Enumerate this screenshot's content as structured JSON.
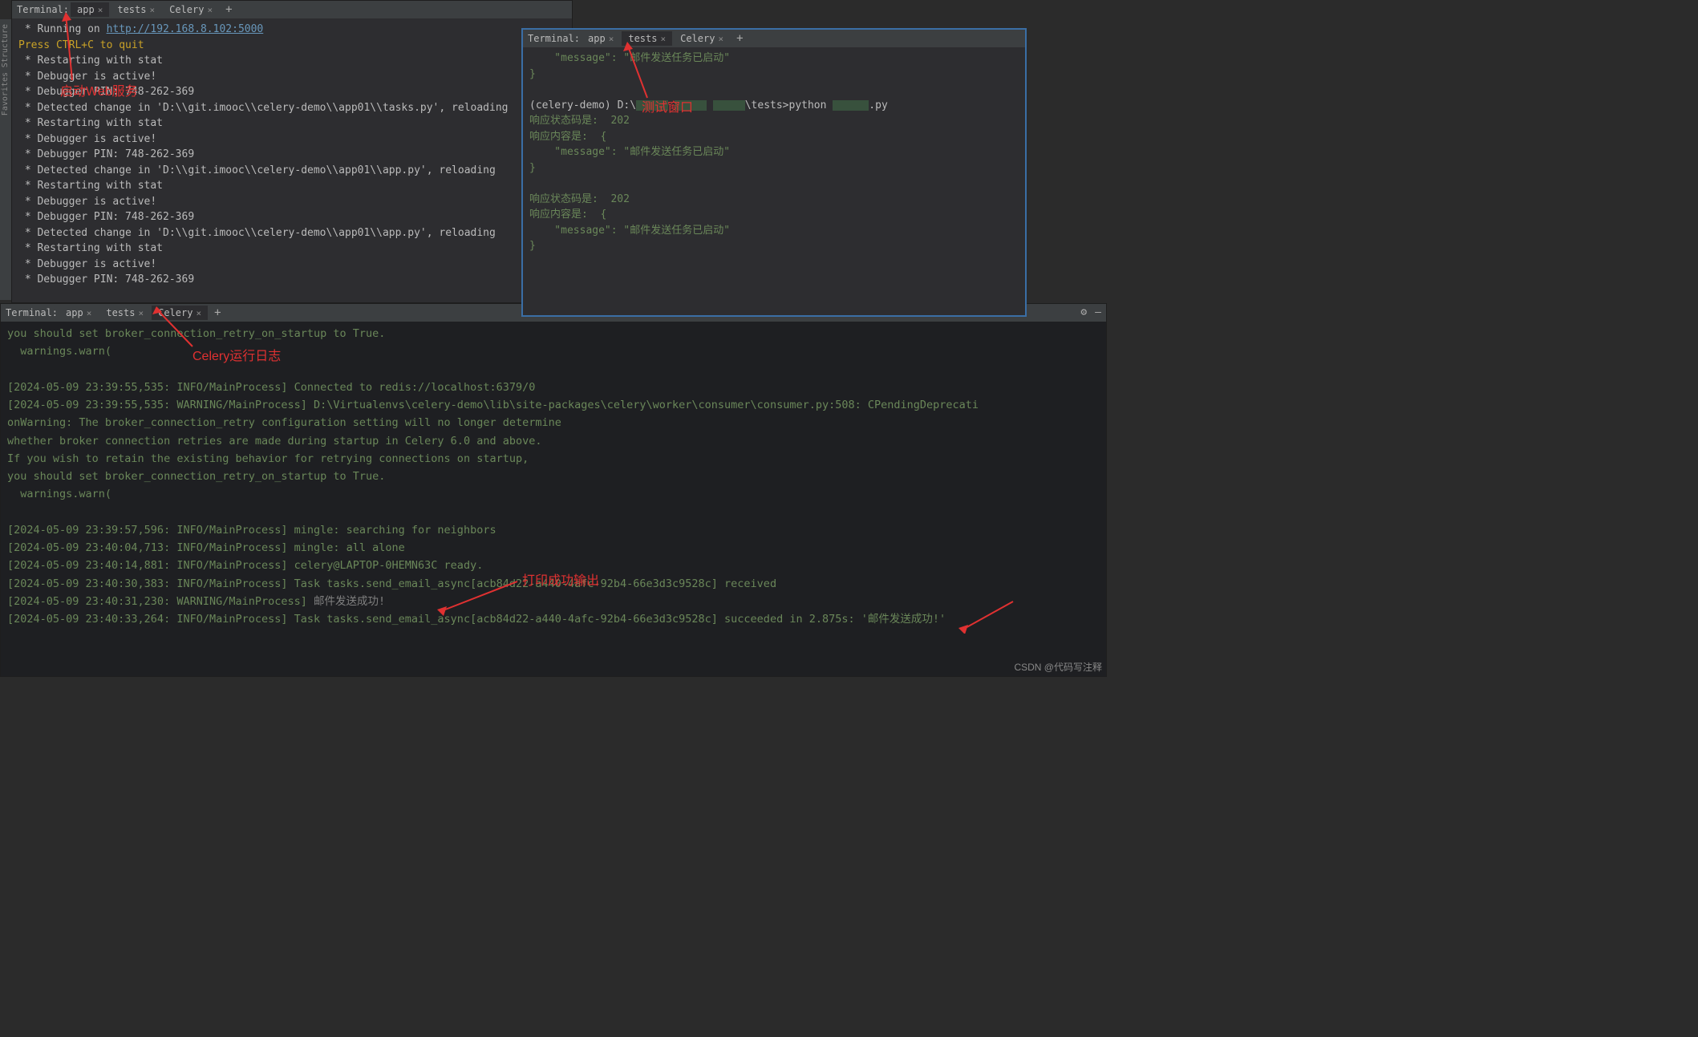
{
  "tabs_label": "Terminal:",
  "tab_app": "app",
  "tab_tests": "tests",
  "tab_celery": "Celery",
  "sidebar": {
    "favorites": "Favorites",
    "structure": "Structure"
  },
  "p1": {
    "l1a": " * Running on ",
    "l1b": "http://192.168.8.102:5000",
    "l2": "Press CTRL+C to quit",
    "l3": " * Restarting with stat",
    "l4": " * Debugger is active!",
    "l5": " * Debugger PIN: 748-262-369",
    "l6": " * Detected change in 'D:\\\\git.imooc\\\\celery-demo\\\\app01\\\\tasks.py', reloading",
    "l7": " * Restarting with stat",
    "l8": " * Debugger is active!",
    "l9": " * Debugger PIN: 748-262-369",
    "l10": " * Detected change in 'D:\\\\git.imooc\\\\celery-demo\\\\app01\\\\app.py', reloading",
    "l11": " * Restarting with stat",
    "l12": " * Debugger is active!",
    "l13": " * Debugger PIN: 748-262-369",
    "l14": " * Detected change in 'D:\\\\git.imooc\\\\celery-demo\\\\app01\\\\app.py', reloading",
    "l15": " * Restarting with stat",
    "l16": " * Debugger is active!",
    "l17": " * Debugger PIN: 748-262-369"
  },
  "p2": {
    "l1a": "    \"message\": \"",
    "l1b": "邮件发送任务已启动\"",
    "l2": "}",
    "prompt_a": "(celery-demo) D:\\",
    "prompt_b": "\\tests>python ",
    "prompt_c": ".py",
    "s1": "响应状态码是:  202",
    "s2": "响应内容是:  {",
    "s3": "    \"message\": \"邮件发送任务已启动\"",
    "s4": "}",
    "s5": "响应状态码是:  202",
    "s6": "响应内容是:  {",
    "s7": "    \"message\": \"邮件发送任务已启动\"",
    "s8": "}"
  },
  "p3": {
    "l0": "you should set broker_connection_retry_on_startup to True.",
    "l1": "  warnings.warn(",
    "l3": "[2024-05-09 23:39:55,535: INFO/MainProcess] Connected to redis://localhost:6379/0",
    "l4": "[2024-05-09 23:39:55,535: WARNING/MainProcess] D:\\Virtualenvs\\celery-demo\\lib\\site-packages\\celery\\worker\\consumer\\consumer.py:508: CPendingDeprecati",
    "l5": "onWarning: The broker_connection_retry configuration setting will no longer determine",
    "l6": "whether broker connection retries are made during startup in Celery 6.0 and above.",
    "l7": "If you wish to retain the existing behavior for retrying connections on startup,",
    "l8": "you should set broker_connection_retry_on_startup to True.",
    "l9": "  warnings.warn(",
    "l11": "[2024-05-09 23:39:57,596: INFO/MainProcess] mingle: searching for neighbors",
    "l12": "[2024-05-09 23:40:04,713: INFO/MainProcess] mingle: all alone",
    "l13": "[2024-05-09 23:40:14,881: INFO/MainProcess] celery@LAPTOP-0HEMN63C ready.",
    "l14": "[2024-05-09 23:40:30,383: INFO/MainProcess] Task tasks.send_email_async[acb84d22-a440-4afc-92b4-66e3d3c9528c] received",
    "l15a": "[2024-05-09 23:40:31,230: WARNING/MainProcess] ",
    "l15b": "邮件发送成功!",
    "l16": "[2024-05-09 23:40:33,264: INFO/MainProcess] Task tasks.send_email_async[acb84d22-a440-4afc-92b4-66e3d3c9528c] succeeded in 2.875s: '邮件发送成功!'"
  },
  "annot": {
    "a1": "启动Web服务",
    "a2": "测试窗口",
    "a3": "Celery运行日志",
    "a4": "打印成功输出"
  },
  "watermark": "CSDN @代码写注释",
  "icons": {
    "gear": "⚙",
    "minus": "—"
  }
}
